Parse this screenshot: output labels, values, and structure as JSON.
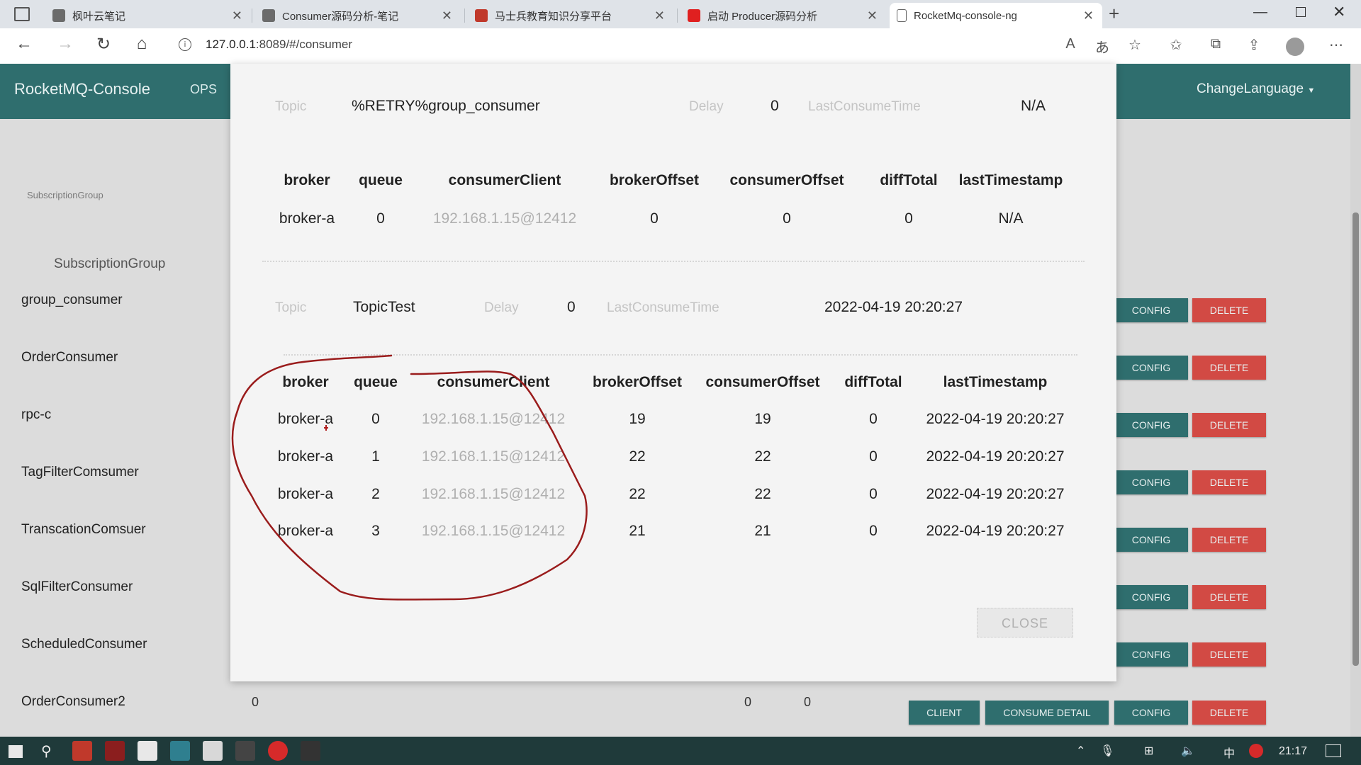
{
  "browser": {
    "tabs": [
      {
        "label": "枫叶云笔记",
        "icon": "note-icon",
        "color": "#6b6b6b"
      },
      {
        "label": "Consumer源码分析-笔记",
        "icon": "note-icon",
        "color": "#6b6b6b"
      },
      {
        "label": "马士兵教育知识分享平台",
        "icon": "site-icon",
        "color": "#c0392b"
      },
      {
        "label": "启动 Producer源码分析",
        "icon": "video-icon",
        "color": "#e02020"
      },
      {
        "label": "RocketMq-console-ng",
        "icon": "page-icon",
        "color": "#ffffff"
      }
    ],
    "url_host": "127.0.0.1",
    "url_rest": ":8089/#/consumer"
  },
  "app": {
    "brand": "RocketMQ-Console",
    "nav_ops": "OPS",
    "change_language": "ChangeLanguage"
  },
  "background": {
    "label": "SubscriptionGroup",
    "header": "SubscriptionGroup",
    "groups": [
      "group_consumer",
      "OrderConsumer",
      "rpc-c",
      "TagFilterComsumer",
      "TranscationComsuer",
      "SqlFilterConsumer",
      "ScheduledConsumer",
      "OrderConsumer2"
    ],
    "config_label": "CONFIG",
    "delete_label": "DELETE",
    "client_label": "CLIENT",
    "consume_detail_label": "CONSUME DETAIL",
    "last_row_values": [
      "0",
      "0",
      "0"
    ]
  },
  "modal": {
    "columns": [
      "broker",
      "queue",
      "consumerClient",
      "brokerOffset",
      "consumerOffset",
      "diffTotal",
      "lastTimestamp"
    ],
    "topic_label": "Topic",
    "delay_label": "Delay",
    "last_consume_label": "LastConsumeTime",
    "topic1": {
      "name": "%RETRY%group_consumer",
      "delay": "0",
      "last_consume_time": "N/A",
      "rows": [
        [
          "broker-a",
          "0",
          "192.168.1.15@12412",
          "0",
          "0",
          "0",
          "N/A"
        ]
      ]
    },
    "topic2": {
      "name": "TopicTest",
      "delay": "0",
      "last_consume_time": "2022-04-19 20:20:27",
      "rows": [
        [
          "broker-a",
          "0",
          "192.168.1.15@12412",
          "19",
          "19",
          "0",
          "2022-04-19 20:20:27"
        ],
        [
          "broker-a",
          "1",
          "192.168.1.15@12412",
          "22",
          "22",
          "0",
          "2022-04-19 20:20:27"
        ],
        [
          "broker-a",
          "2",
          "192.168.1.15@12412",
          "22",
          "22",
          "0",
          "2022-04-19 20:20:27"
        ],
        [
          "broker-a",
          "3",
          "192.168.1.15@12412",
          "21",
          "21",
          "0",
          "2022-04-19 20:20:27"
        ]
      ]
    },
    "close_label": "CLOSE"
  },
  "taskbar": {
    "time": "21:17",
    "ime": "中"
  }
}
